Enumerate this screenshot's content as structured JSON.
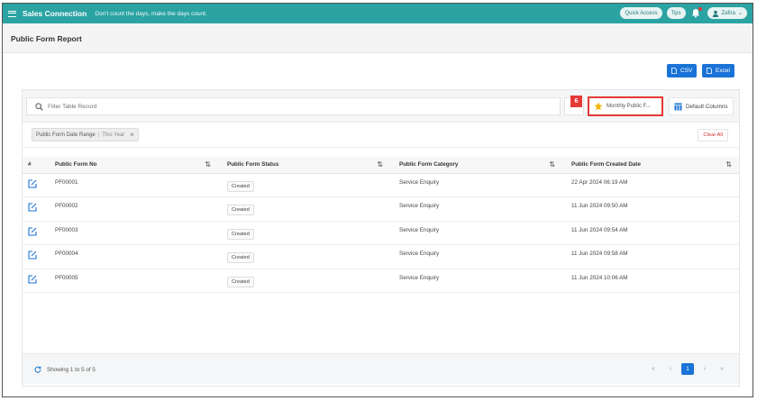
{
  "topbar": {
    "brand": "Sales Connection",
    "tagline": "Don't count the days, make the days count.",
    "quick_access": "Quick Access",
    "tips": "Tips",
    "user": "Zafira"
  },
  "page": {
    "title": "Public Form Report"
  },
  "export": {
    "csv": "CSV",
    "excel": "Excel"
  },
  "filter": {
    "search_placeholder": "Filter Table Record",
    "saved_filter": "Monthly Public F...",
    "step_badge": "6",
    "default_columns": "Default Columns"
  },
  "chip": {
    "label": "Public Form Date Range",
    "value": "This Year"
  },
  "clear_all": "Clear All",
  "table": {
    "headers": [
      "#",
      "Public Form No",
      "Public Form Status",
      "Public Form Category",
      "Public Form Created Date"
    ],
    "rows": [
      {
        "no": "PF00001",
        "status": "Created",
        "category": "Service Enquiry",
        "date": "22 Apr 2024 06:19 AM"
      },
      {
        "no": "PF00002",
        "status": "Created",
        "category": "Service Enquiry",
        "date": "11 Jun 2024 09:50 AM"
      },
      {
        "no": "PF00003",
        "status": "Created",
        "category": "Service Enquiry",
        "date": "11 Jun 2024 09:54 AM"
      },
      {
        "no": "PF00004",
        "status": "Created",
        "category": "Service Enquiry",
        "date": "11 Jun 2024 09:58 AM"
      },
      {
        "no": "PF00005",
        "status": "Created",
        "category": "Service Enquiry",
        "date": "11 Jun 2024 10:06 AM"
      }
    ]
  },
  "footer": {
    "showing": "Showing 1 to 5 of 5",
    "first": "«",
    "prev": "‹",
    "page": "1",
    "next": "›",
    "last": "»"
  },
  "colors": {
    "teal": "#2ba3a3",
    "blue": "#1a73d6",
    "red": "#e53935"
  }
}
